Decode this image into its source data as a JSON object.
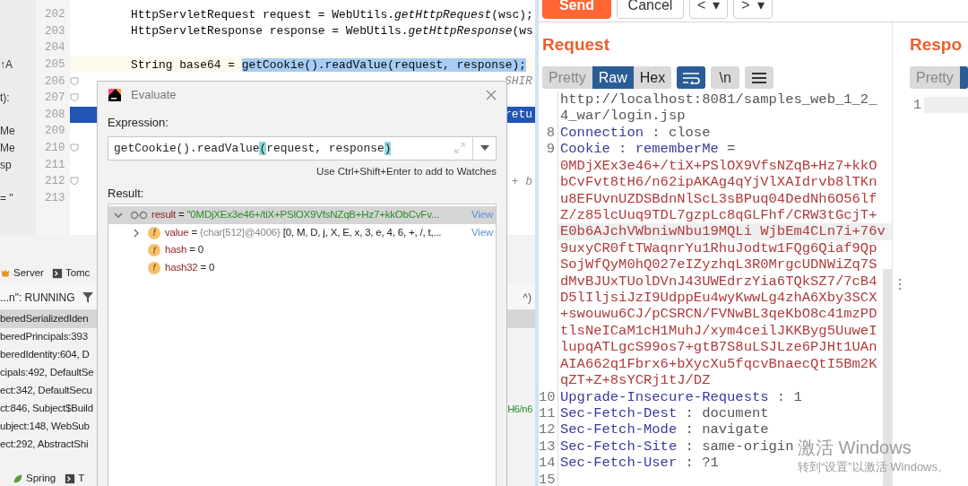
{
  "editor": {
    "lines": [
      {
        "number": "202",
        "kind": "normal",
        "fold": false,
        "code": "HttpServletRequest request = WebUtils.*getHttpRequest*(wsc);"
      },
      {
        "number": "203",
        "kind": "normal",
        "fold": false,
        "code": "HttpServletResponse response = WebUtils.*getHttpResponse*(ws"
      },
      {
        "number": "204",
        "kind": "normal",
        "fold": false
      },
      {
        "number": "205",
        "kind": "caret",
        "fold": false,
        "side": "↑A",
        "code": "String base64 = ",
        "selection": "getCookie().readValue(request, response);"
      },
      {
        "number": "206",
        "kind": "normal",
        "fold": true,
        "tail": "SHIR"
      },
      {
        "number": "207",
        "kind": "normal",
        "fold": true,
        "side": "t):"
      },
      {
        "number": "208",
        "kind": "execution",
        "fold": false,
        "tail": "retu"
      },
      {
        "number": "209",
        "kind": "normal",
        "fold": false,
        "side": "Me"
      },
      {
        "number": "210",
        "kind": "normal",
        "fold": true,
        "side": "Me"
      },
      {
        "number": "211",
        "kind": "normal",
        "fold": false,
        "side": "sp"
      },
      {
        "number": "212",
        "kind": "normal",
        "fold": true,
        "tail": "+ b"
      },
      {
        "number": "213",
        "kind": "normal",
        "fold": false,
        "side": "= \""
      }
    ]
  },
  "debug_panel": {
    "tabs": [
      {
        "label": "Server"
      },
      {
        "label": "Tomc"
      }
    ],
    "status": "...n\": RUNNING",
    "status_aside": "^)",
    "frames": [
      {
        "text": "beredSerializedIden",
        "selected": true
      },
      {
        "text": "beredPrincipals:393",
        "selected": false
      },
      {
        "text": "beredIdentity:604, D",
        "selected": false
      },
      {
        "text": "cipals:492, DefaultSe",
        "selected": false
      },
      {
        "text": "ect:342, DefaultSecu",
        "selected": false
      },
      {
        "text": "ct:846, Subject$Build",
        "selected": false,
        "aside": "H6/n6"
      },
      {
        "text": "ubject:148, WebSub",
        "selected": false
      },
      {
        "text": "ect:292, AbstractShi",
        "selected": false
      }
    ],
    "bottom_tabs": [
      {
        "label": "Spring"
      },
      {
        "label": "T"
      }
    ]
  },
  "evaluate_dialog": {
    "title": "Evaluate",
    "expression_label": "Expression:",
    "expression": [
      {
        "text": "getCookie().readValue",
        "brace": false
      },
      {
        "text": "(",
        "brace": true
      },
      {
        "text": "request, response",
        "brace": false
      },
      {
        "text": ")",
        "brace": true
      }
    ],
    "hint": "Use Ctrl+Shift+Enter to add to Watches",
    "result_label": "Result:",
    "tree": [
      {
        "kind": "watch",
        "name": "result",
        "separator": "=",
        "value": "\"0MDjXEx3e46+/tiX+PSlOX9VfsNZqB+Hz7+kkObCvFv...",
        "link": "View",
        "expanded": true,
        "selected": true,
        "children": [
          {
            "kind": "field",
            "badge": "f",
            "name": "value",
            "separator": "=",
            "type": "{char[512]@4006}",
            "value": "[0, M, D, j, X, E, x, 3, e, 4, 6, +, /, t,...",
            "link": "View",
            "expanded": false,
            "selected": false
          },
          {
            "kind": "field",
            "badge": "f",
            "name": "hash",
            "separator": "=",
            "value": "0",
            "selected": false
          },
          {
            "kind": "field",
            "badge": "f",
            "name": "hash32",
            "separator": "=",
            "value": "0",
            "selected": false
          }
        ]
      }
    ]
  },
  "repeater": {
    "toolbar": [
      {
        "label": "Send",
        "kind": "primary"
      },
      {
        "label": "Cancel",
        "kind": "default"
      },
      {
        "label": "<",
        "kind": "nav",
        "dropdown": "▾"
      },
      {
        "label": ">",
        "kind": "nav",
        "dropdown": "▾"
      }
    ],
    "request": {
      "title": "Request",
      "view_tabs": [
        {
          "label": "Pretty",
          "selected": false
        },
        {
          "label": "Raw",
          "selected": true
        },
        {
          "label": "Hex",
          "selected": false
        }
      ],
      "tools": [
        {
          "kind": "wrap",
          "on": true
        },
        {
          "kind": "newline",
          "label": "\\n",
          "on": false
        },
        {
          "kind": "menu",
          "on": false
        }
      ],
      "lines": [
        {
          "current": false,
          "parts": [
            {
              "text": "http://localhost:8081/samples_web_1_2_",
              "kind": "plain"
            }
          ]
        },
        {
          "current": false,
          "parts": [
            {
              "text": "4_war/login.jsp",
              "kind": "plain"
            }
          ]
        },
        {
          "number": "8",
          "current": false,
          "parts": [
            {
              "text": "Connection",
              "kind": "key"
            },
            {
              "text": " : close",
              "kind": "plain"
            }
          ]
        },
        {
          "number": "9",
          "current": false,
          "parts": [
            {
              "text": "Cookie",
              "kind": "key"
            },
            {
              "text": " : ",
              "kind": "plain"
            },
            {
              "text": "rememberMe",
              "kind": "key"
            },
            {
              "text": " =",
              "kind": "plain"
            }
          ]
        },
        {
          "current": false,
          "parts": [
            {
              "text": "0MDjXEx3e46+/tiX+PSlOX9VfsNZqB+Hz7+kkO",
              "kind": "value"
            }
          ]
        },
        {
          "current": false,
          "parts": [
            {
              "text": "bCvFvt8tH6/n62ipAKAg4qYjVlXAIdrvb8lTKn",
              "kind": "value"
            }
          ]
        },
        {
          "current": false,
          "parts": [
            {
              "text": "u8EFUvnUZDSBdnNlScL3sBPuq04DedNh6O56lf",
              "kind": "value"
            }
          ]
        },
        {
          "current": false,
          "parts": [
            {
              "text": "Z/z85lcUuq9TDL7gzpLc8qGLFhf/CRW3tGcjT+",
              "kind": "value"
            }
          ]
        },
        {
          "current": true,
          "parts": [
            {
              "text": "E0b6AJchVWbniwNbu19MQLi WjbEm4CLn7i+76v",
              "kind": "value"
            }
          ]
        },
        {
          "current": false,
          "parts": [
            {
              "text": "9uxyCR0ftTWaqnrYu1RhuJodtw1FQg6Qiaf9Qp",
              "kind": "value"
            }
          ]
        },
        {
          "current": false,
          "parts": [
            {
              "text": "SojWfQyM0hQ027eIZyzhqL3R0MrgcUDNWiZq7S",
              "kind": "value"
            }
          ]
        },
        {
          "current": false,
          "parts": [
            {
              "text": "dMvBJUxTUolDVnJ43UWEdrzYia6TQkSZ7/7cB4",
              "kind": "value"
            }
          ]
        },
        {
          "current": false,
          "parts": [
            {
              "text": "D5lIljsiJzI9UdppEu4wyKwwLg4zhA6Xby3SCX",
              "kind": "value"
            }
          ]
        },
        {
          "current": false,
          "parts": [
            {
              "text": "+swouwu6CJ/pCSRCN/FVNwBL3qeKbO8c41mzPD",
              "kind": "value"
            }
          ]
        },
        {
          "current": false,
          "parts": [
            {
              "text": "tlsNeICaM1cH1MuhJ/xym4ceilJKKByg5UuweI",
              "kind": "value"
            }
          ]
        },
        {
          "current": false,
          "parts": [
            {
              "text": "lupqATLgcS99os7+gtB7S8uLSJLze6PJHt1UAn",
              "kind": "value"
            }
          ]
        },
        {
          "current": false,
          "parts": [
            {
              "text": "AIA662q1Fbrx6+bXycXu5fqcvBnaecQtI5Bm2K",
              "kind": "value"
            }
          ]
        },
        {
          "current": false,
          "parts": [
            {
              "text": "qZT+Z+8sYCRj1tJ/DZ",
              "kind": "value"
            }
          ]
        },
        {
          "number": "10",
          "current": false,
          "parts": [
            {
              "text": "Upgrade-Insecure-Requests",
              "kind": "key"
            },
            {
              "text": " : 1",
              "kind": "plain"
            }
          ]
        },
        {
          "number": "11",
          "current": false,
          "parts": [
            {
              "text": "Sec-Fetch-Dest",
              "kind": "key"
            },
            {
              "text": " : document",
              "kind": "plain"
            }
          ]
        },
        {
          "number": "12",
          "current": false,
          "parts": [
            {
              "text": "Sec-Fetch-Mode",
              "kind": "key"
            },
            {
              "text": " : navigate",
              "kind": "plain"
            }
          ]
        },
        {
          "number": "13",
          "current": false,
          "parts": [
            {
              "text": "Sec-Fetch-Site",
              "kind": "key"
            },
            {
              "text": " : same-origin",
              "kind": "plain"
            }
          ]
        },
        {
          "number": "14",
          "current": false,
          "parts": [
            {
              "text": "Sec-Fetch-User",
              "kind": "key"
            },
            {
              "text": " : ?1",
              "kind": "plain"
            }
          ]
        },
        {
          "number": "15",
          "current": false
        }
      ]
    },
    "response": {
      "title": "Respo",
      "view_tabs": [
        {
          "label": "Pretty",
          "selected": false
        },
        {
          "selected": true
        }
      ],
      "lines": [
        {
          "number": "1",
          "current": true
        }
      ]
    }
  },
  "activation_notice": {
    "title": "激活 Windows",
    "subtitle": "转到“设置”以激活 Windows。"
  }
}
